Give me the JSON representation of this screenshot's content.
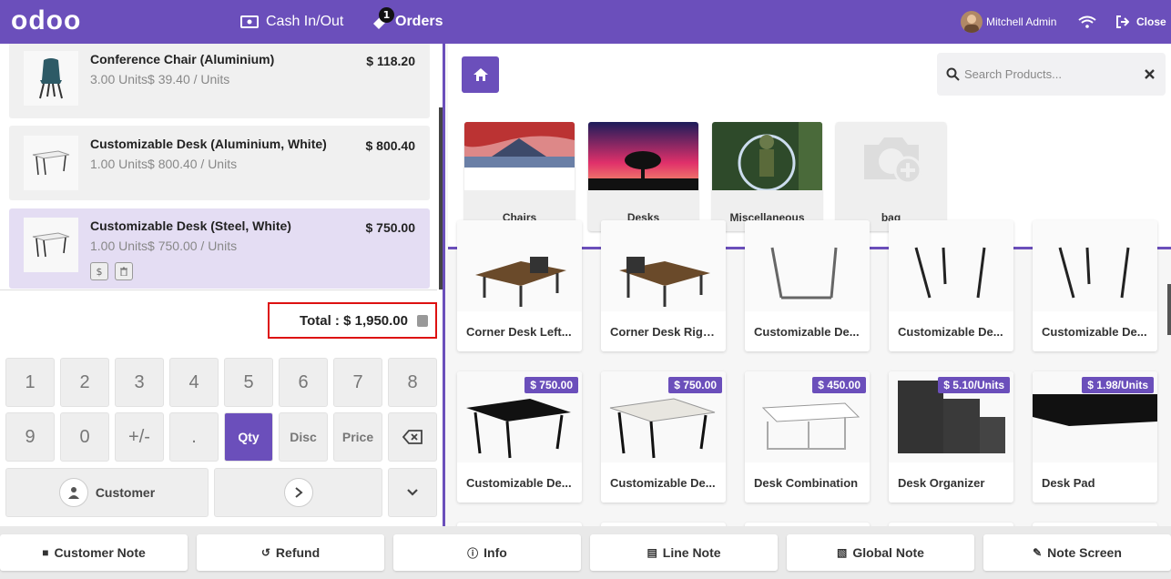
{
  "topbar": {
    "logo": "odoo",
    "cash_label": "Cash In/Out",
    "orders_label": "Orders",
    "orders_badge": "1",
    "user_name": "Mitchell Admin",
    "close_label": "Close"
  },
  "order_lines": [
    {
      "name": "Conference Chair (Aluminium)",
      "info": "3.00 Units$ 39.40 / Units",
      "price": "$ 118.20"
    },
    {
      "name": "Customizable Desk (Aluminium, White)",
      "info": "1.00 Units$ 800.40 / Units",
      "price": "$ 800.40"
    },
    {
      "name": "Customizable Desk (Steel, White)",
      "info": "1.00 Units$ 750.00 / Units",
      "price": "$ 750.00"
    }
  ],
  "total": "Total : $ 1,950.00",
  "numpad": {
    "row1": [
      "1",
      "2",
      "3",
      "4",
      "5",
      "6",
      "7",
      "8"
    ],
    "row2": [
      "9",
      "0",
      "+/-",
      ".",
      "Qty",
      "Disc",
      "Price"
    ],
    "customer_label": "Customer"
  },
  "search": {
    "placeholder": "Search Products..."
  },
  "categories": [
    "Chairs",
    "Desks",
    "Miscellaneous",
    "bag"
  ],
  "products_row1": [
    "Corner Desk Left...",
    "Corner Desk Righ...",
    "Customizable De...",
    "Customizable De...",
    "Customizable De..."
  ],
  "products_row2": [
    {
      "name": "Customizable De...",
      "price": "$ 750.00"
    },
    {
      "name": "Customizable De...",
      "price": "$ 750.00"
    },
    {
      "name": "Desk Combination",
      "price": "$ 450.00"
    },
    {
      "name": "Desk Organizer",
      "price": "$ 5.10/Units"
    },
    {
      "name": "Desk Pad",
      "price": "$ 1.98/Units"
    }
  ],
  "bottom_actions": [
    "Customer Note",
    "Refund",
    "Info",
    "Line Note",
    "Global Note",
    "Note Screen"
  ],
  "colors": {
    "accent": "#6b4fbb",
    "highlight": "#e4ddf3",
    "total_border": "#dd1111"
  }
}
